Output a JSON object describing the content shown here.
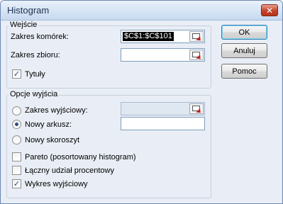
{
  "window": {
    "title": "Histogram",
    "close_glyph": "✕"
  },
  "input_group": {
    "label": "Wejście",
    "range_label": "Zakres komórek:",
    "range_value": "$C$1:$C$101",
    "bin_label": "Zakres zbioru:",
    "bin_value": "",
    "labels_checkbox": {
      "label": "Tytuły",
      "checked": true
    }
  },
  "output_group": {
    "label": "Opcje wyjścia",
    "options": [
      {
        "label": "Zakres wyjściowy:",
        "selected": false
      },
      {
        "label": "Nowy arkusz:",
        "selected": true
      },
      {
        "label": "Nowy skoroszyt",
        "selected": false
      }
    ],
    "output_range_value": "",
    "new_sheet_value": "",
    "checkboxes": [
      {
        "label": "Pareto (posortowany histogram)",
        "checked": false
      },
      {
        "label": "Łączny udział procentowy",
        "checked": false
      },
      {
        "label": "Wykres wyjściowy",
        "checked": true
      }
    ]
  },
  "buttons": {
    "ok": "OK",
    "cancel": "Anuluj",
    "help": "Pomoc"
  },
  "icons": {
    "range_picker": "collapse-dialog-icon",
    "check": "✓"
  },
  "colors": {
    "title_text": "#1e2f4d",
    "close": "#c2432a",
    "accent": "#3c7fb1"
  }
}
